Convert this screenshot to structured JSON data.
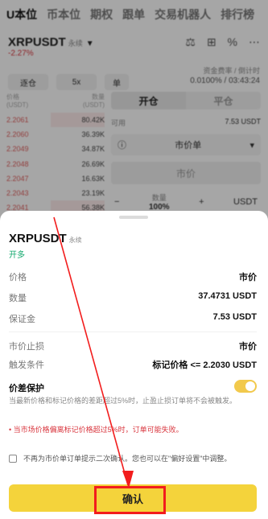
{
  "top_tabs": [
    "U本位",
    "币本位",
    "期权",
    "跟单",
    "交易机器人",
    "排行榜"
  ],
  "header": {
    "pair": "XRPUSDT",
    "pair_type": "永续",
    "change": "-2.27%"
  },
  "funding": {
    "label": "资金费率 / 倒计时",
    "value": "0.0100% / 03:43:24"
  },
  "chips": [
    "逐仓",
    "5x",
    "单"
  ],
  "order_book": {
    "price_label": "价格\n(USDT)",
    "qty_label": "数量\n(USDT)",
    "rows": [
      {
        "price": "2.2061",
        "qty": "80.42K"
      },
      {
        "price": "2.2060",
        "qty": "36.39K"
      },
      {
        "price": "2.2049",
        "qty": "34.87K"
      },
      {
        "price": "2.2048",
        "qty": "26.69K"
      },
      {
        "price": "2.2047",
        "qty": "16.63K"
      },
      {
        "price": "2.2043",
        "qty": "23.19K"
      },
      {
        "price": "2.2041",
        "qty": "56.38K"
      }
    ]
  },
  "panel": {
    "open_tab": "开仓",
    "close_tab": "平仓",
    "avail_label": "可用",
    "avail_value": "7.53 USDT",
    "order_type": "市价单",
    "price_placeholder": "市价",
    "qty_label": "数量",
    "qty_unit": "USDT",
    "qty_value": "100%"
  },
  "sheet": {
    "title": "XRPUSDT",
    "title_tag": "永续",
    "side": "开多",
    "rows": [
      {
        "label": "价格",
        "value": "市价"
      },
      {
        "label": "数量",
        "value": "37.4731 USDT"
      },
      {
        "label": "保证金",
        "value": "7.53 USDT"
      },
      {
        "label": "市价止损",
        "value": "市价"
      },
      {
        "label": "触发条件",
        "value": "标记价格 <= 2.2030 USDT"
      }
    ],
    "protection_title": "价差保护",
    "protection_desc": "当最新价格和标记价格的差距超过5%时，止盈止损订单将不会被触发。",
    "warning": "• 当市场价格偏离标记价格超过5%时，订单可能失败。",
    "checkbox_text": "不再为市价单订单提示二次确认。您也可以在\"偏好设置\"中调整。",
    "confirm_label": "确认"
  },
  "colors": {
    "accent": "#f4d33b",
    "highlight": "#f21d1d",
    "long": "#14a96e",
    "short": "#d9363e"
  }
}
